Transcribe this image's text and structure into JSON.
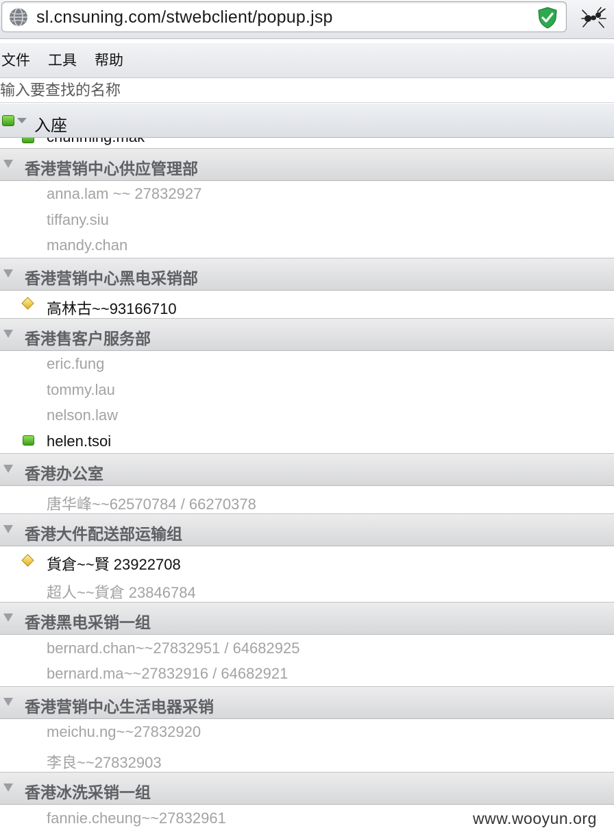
{
  "browser": {
    "url": "sl.cnsuning.com/stwebclient/popup.jsp"
  },
  "menu": {
    "items": [
      "文件",
      "工具",
      "帮助"
    ]
  },
  "search": {
    "placeholder": "输入要查找的名称"
  },
  "status": {
    "label": "入座"
  },
  "list": {
    "cutoff_member": "chunming.mak",
    "groups": [
      {
        "name": "香港营销中心供应管理部",
        "members": [
          {
            "name": "anna.lam ~~ 27832927",
            "status": "offline"
          },
          {
            "name": "tiffany.siu",
            "status": "offline"
          },
          {
            "name": "mandy.chan",
            "status": "offline"
          }
        ]
      },
      {
        "name": "香港营销中心黑电采销部",
        "members": [
          {
            "name": "高林古~~93166710",
            "status": "away"
          }
        ]
      },
      {
        "name": "香港售客户服务部",
        "members": [
          {
            "name": "eric.fung",
            "status": "offline"
          },
          {
            "name": "tommy.lau",
            "status": "offline"
          },
          {
            "name": "nelson.law",
            "status": "offline"
          },
          {
            "name": "helen.tsoi",
            "status": "online"
          }
        ]
      },
      {
        "name": "香港办公室",
        "members": [
          {
            "name": "唐华峰~~62570784 / 66270378",
            "status": "offline"
          }
        ]
      },
      {
        "name": "香港大件配送部运输组",
        "members": [
          {
            "name": "貨倉~~賢 23922708",
            "status": "away"
          },
          {
            "name": "超人~~貨倉 23846784",
            "status": "offline"
          }
        ]
      },
      {
        "name": "香港黑电采销一组",
        "members": [
          {
            "name": "bernard.chan~~27832951 / 64682925",
            "status": "offline"
          },
          {
            "name": "bernard.ma~~27832916 / 64682921",
            "status": "offline"
          }
        ]
      },
      {
        "name": "香港营销中心生活电器采销",
        "members": [
          {
            "name": "meichu.ng~~27832920",
            "status": "offline"
          },
          {
            "name": "李良~~27832903",
            "status": "offline"
          }
        ]
      },
      {
        "name": "香港冰洗采销一组",
        "members": [
          {
            "name": "fannie.cheung~~27832961",
            "status": "offline"
          }
        ]
      }
    ]
  },
  "watermark": "www.wooyun.org",
  "colors": {
    "online": "#4caf25",
    "away": "#e6bb2a",
    "offline_text": "#a3a3a3",
    "shield": "#2fa84f"
  }
}
